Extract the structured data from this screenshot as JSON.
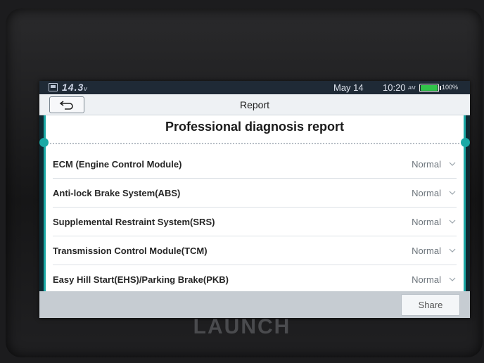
{
  "statusbar": {
    "voltage": "14.3",
    "voltage_unit": "v",
    "date": "May 14",
    "time": "10:20",
    "ampm": "AM",
    "battery_level": 1.0,
    "battery_pct": "100%",
    "battery_color": "#31c44a"
  },
  "header": {
    "title": "Report",
    "back_icon": "back-arrow-icon"
  },
  "report": {
    "heading": "Professional diagnosis report",
    "items": [
      {
        "label": "ECM (Engine Control Module)",
        "status": "Normal"
      },
      {
        "label": "Anti-lock Brake System(ABS)",
        "status": "Normal"
      },
      {
        "label": "Supplemental Restraint System(SRS)",
        "status": "Normal"
      },
      {
        "label": "Transmission Control Module(TCM)",
        "status": "Normal"
      },
      {
        "label": "Easy Hill Start(EHS)/Parking Brake(PKB)",
        "status": "Normal"
      }
    ]
  },
  "footer": {
    "share_label": "Share"
  },
  "device": {
    "brand": "LAUNCH"
  },
  "colors": {
    "accent": "#1aa9a6",
    "statusbar": "#1f2a36"
  }
}
